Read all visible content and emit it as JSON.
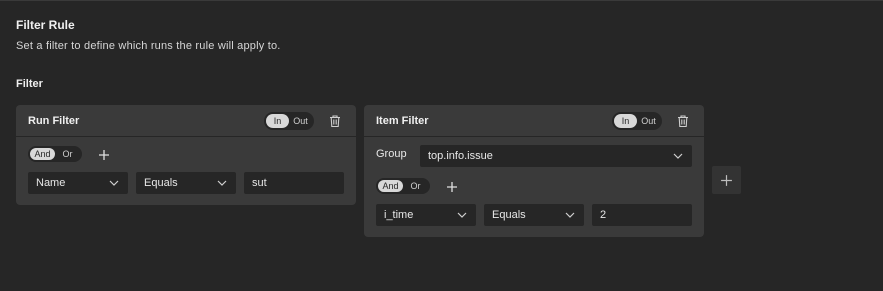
{
  "header": {
    "title": "Filter Rule",
    "description": "Set a filter to define which runs the rule will apply to.",
    "section_label": "Filter"
  },
  "run_filter": {
    "title": "Run Filter",
    "toggle": {
      "in": "In",
      "out": "Out",
      "selected": "In"
    },
    "logic": {
      "and": "And",
      "or": "Or",
      "selected": "And"
    },
    "condition": {
      "field": "Name",
      "operator": "Equals",
      "value": "sut"
    }
  },
  "item_filter": {
    "title": "Item Filter",
    "toggle": {
      "in": "In",
      "out": "Out",
      "selected": "In"
    },
    "group_label": "Group",
    "group_value": "top.info.issue",
    "logic": {
      "and": "And",
      "or": "Or",
      "selected": "And"
    },
    "condition": {
      "field": "i_time",
      "operator": "Equals",
      "value": "2"
    }
  },
  "icons": {
    "trash": "trash-icon",
    "plus": "plus-icon",
    "chevron": "chevron-down-icon"
  },
  "colors": {
    "background": "#262626",
    "card": "#3a3a3a",
    "field": "#262626",
    "toggle_active": "#d8d8d8",
    "text": "#e6e6e6"
  }
}
